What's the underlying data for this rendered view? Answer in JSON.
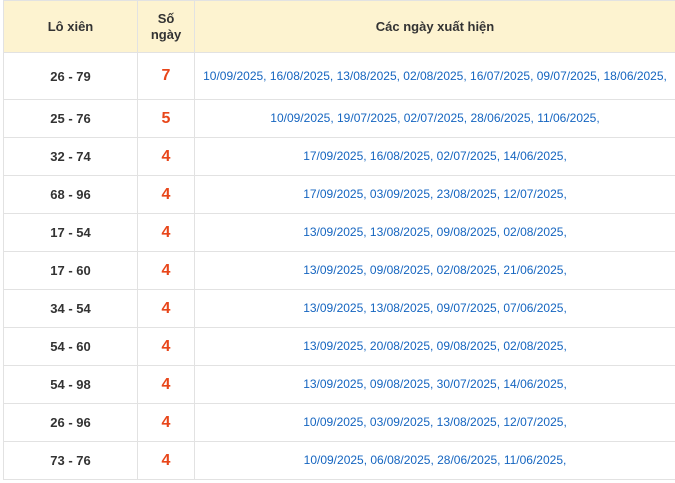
{
  "header": {
    "col_pair": "Lô xiên",
    "col_count_line1": "Số",
    "col_count_line2": "ngày",
    "col_dates": "Các ngày xuất hiện"
  },
  "rows": [
    {
      "pair": "26 - 79",
      "count": "7",
      "dates": "10/09/2025, 16/08/2025, 13/08/2025, 02/08/2025, 16/07/2025, 09/07/2025, 18/06/2025,"
    },
    {
      "pair": "25 - 76",
      "count": "5",
      "dates": "10/09/2025, 19/07/2025, 02/07/2025, 28/06/2025, 11/06/2025,"
    },
    {
      "pair": "32 - 74",
      "count": "4",
      "dates": "17/09/2025, 16/08/2025, 02/07/2025, 14/06/2025,"
    },
    {
      "pair": "68 - 96",
      "count": "4",
      "dates": "17/09/2025, 03/09/2025, 23/08/2025, 12/07/2025,"
    },
    {
      "pair": "17 - 54",
      "count": "4",
      "dates": "13/09/2025, 13/08/2025, 09/08/2025, 02/08/2025,"
    },
    {
      "pair": "17 - 60",
      "count": "4",
      "dates": "13/09/2025, 09/08/2025, 02/08/2025, 21/06/2025,"
    },
    {
      "pair": "34 - 54",
      "count": "4",
      "dates": "13/09/2025, 13/08/2025, 09/07/2025, 07/06/2025,"
    },
    {
      "pair": "54 - 60",
      "count": "4",
      "dates": "13/09/2025, 20/08/2025, 09/08/2025, 02/08/2025,"
    },
    {
      "pair": "54 - 98",
      "count": "4",
      "dates": "13/09/2025, 09/08/2025, 30/07/2025, 14/06/2025,"
    },
    {
      "pair": "26 - 96",
      "count": "4",
      "dates": "10/09/2025, 03/09/2025, 13/08/2025, 12/07/2025,"
    },
    {
      "pair": "73 - 76",
      "count": "4",
      "dates": "10/09/2025, 06/08/2025, 28/06/2025, 11/06/2025,"
    }
  ],
  "colors": {
    "header_bg": "#fdf3d0",
    "count_color": "#e8461a",
    "dates_color": "#1565c0",
    "border": "#e2e2e2"
  }
}
